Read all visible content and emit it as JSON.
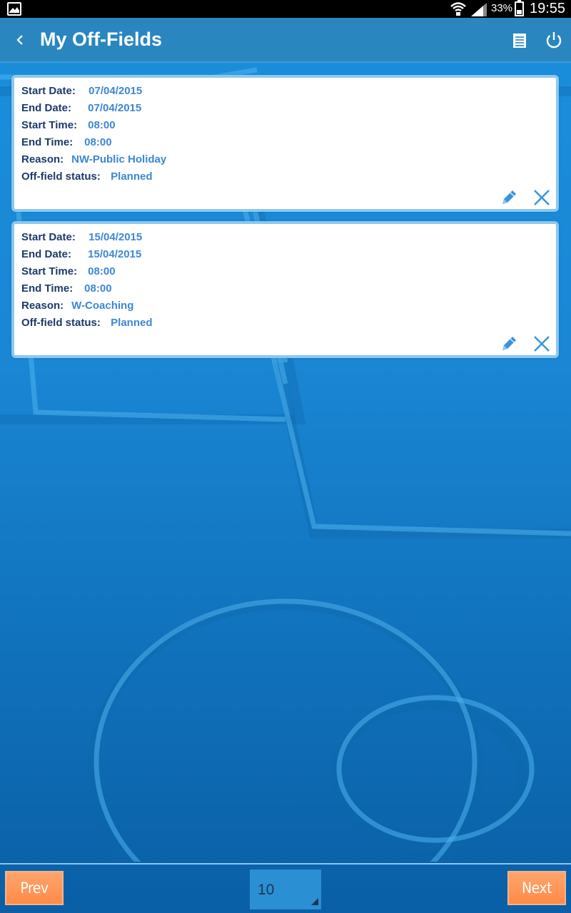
{
  "status_bar": {
    "battery_percent": "33%",
    "time": "19:55"
  },
  "app_bar": {
    "title": "My Off-Fields"
  },
  "off_fields": [
    {
      "start_date_label": "Start Date:",
      "start_date": "07/04/2015",
      "end_date_label": "End Date:",
      "end_date": "07/04/2015",
      "start_time_label": "Start Time:",
      "start_time": "08:00",
      "end_time_label": "End Time:",
      "end_time": "08:00",
      "reason_label": "Reason:",
      "reason": "NW-Public Holiday",
      "status_label": "Off-field status:",
      "status": "Planned"
    },
    {
      "start_date_label": "Start Date:",
      "start_date": "15/04/2015",
      "end_date_label": "End Date:",
      "end_date": "15/04/2015",
      "start_time_label": "Start Time:",
      "start_time": "08:00",
      "end_time_label": "End Time:",
      "end_time": "08:00",
      "reason_label": "Reason:",
      "reason": "W-Coaching",
      "status_label": "Off-field status:",
      "status": "Planned"
    }
  ],
  "pagination": {
    "prev_label": "Prev",
    "next_label": "Next",
    "page_size": "10"
  },
  "colors": {
    "app_bar": "#2a86bf",
    "label_text": "#1c3a6b",
    "value_text": "#3d86d6",
    "button_orange": "#ff8a47"
  },
  "icons": {
    "status_gallery": "gallery-icon",
    "back": "chevron-left-icon",
    "document": "document-icon",
    "power": "power-icon",
    "edit": "pencil-icon",
    "delete": "close-icon"
  }
}
